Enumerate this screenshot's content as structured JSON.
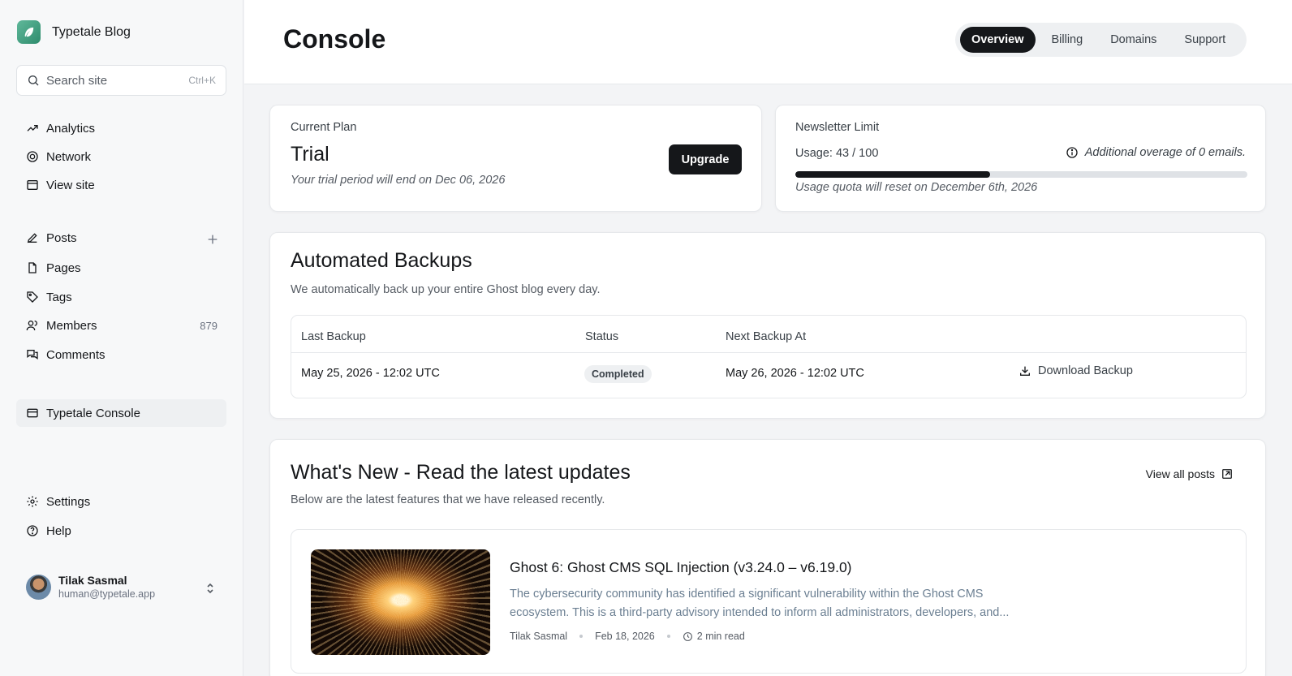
{
  "brand": {
    "name": "Typetale Blog"
  },
  "search": {
    "placeholder": "Search site",
    "shortcut": "Ctrl+K"
  },
  "sidebar": {
    "primary": [
      {
        "label": "Analytics",
        "icon": "trending-up-icon"
      },
      {
        "label": "Network",
        "icon": "network-icon"
      },
      {
        "label": "View site",
        "icon": "browser-window-icon"
      }
    ],
    "content": [
      {
        "label": "Posts",
        "icon": "pen-icon"
      },
      {
        "label": "Pages",
        "icon": "page-icon"
      },
      {
        "label": "Tags",
        "icon": "tag-icon"
      },
      {
        "label": "Members",
        "icon": "members-icon",
        "count": "879"
      },
      {
        "label": "Comments",
        "icon": "comments-icon"
      }
    ],
    "console": {
      "label": "Typetale Console",
      "icon": "card-icon"
    },
    "bottom": [
      {
        "label": "Settings",
        "icon": "gear-icon"
      },
      {
        "label": "Help",
        "icon": "help-icon"
      }
    ]
  },
  "user": {
    "name": "Tilak Sasmal",
    "email": "human@typetale.app"
  },
  "header": {
    "title": "Console",
    "tabs": [
      {
        "label": "Overview",
        "active": true
      },
      {
        "label": "Billing",
        "active": false
      },
      {
        "label": "Domains",
        "active": false
      },
      {
        "label": "Support",
        "active": false
      }
    ]
  },
  "plan": {
    "label": "Current Plan",
    "name": "Trial",
    "note": "Your trial period will end on Dec 06, 2026",
    "upgrade_label": "Upgrade"
  },
  "newsletter": {
    "label": "Newsletter Limit",
    "usage_text": "Usage: 43 / 100",
    "usage_fraction": 0.43,
    "overage": "Additional overage of 0 emails.",
    "reset_note": "Usage quota will reset on December 6th, 2026"
  },
  "backups": {
    "title": "Automated Backups",
    "subtitle": "We automatically back up your entire Ghost blog every day.",
    "columns": [
      "Last Backup",
      "Status",
      "Next Backup At"
    ],
    "row": {
      "last": "May 25, 2026 - 12:02 UTC",
      "status": "Completed",
      "next": "May 26, 2026 - 12:02 UTC",
      "action": "Download Backup"
    }
  },
  "news": {
    "title": "What's New - Read the latest updates",
    "subtitle": "Below are the latest features that we have released recently.",
    "view_all": "View all posts",
    "post": {
      "title": "Ghost 6: Ghost CMS SQL Injection (v3.24.0 – v6.19.0)",
      "excerpt": "The cybersecurity community has identified a significant vulnerability within the Ghost CMS ecosystem. This is a third-party advisory intended to inform all administrators, developers, and...",
      "author": "Tilak Sasmal",
      "date": "Feb 18, 2026",
      "read_time": "2 min read"
    }
  },
  "colors": {
    "primary": "#15171a",
    "muted": "#555b63",
    "border": "#e6e8eb",
    "accent": "#3a9b7a"
  }
}
